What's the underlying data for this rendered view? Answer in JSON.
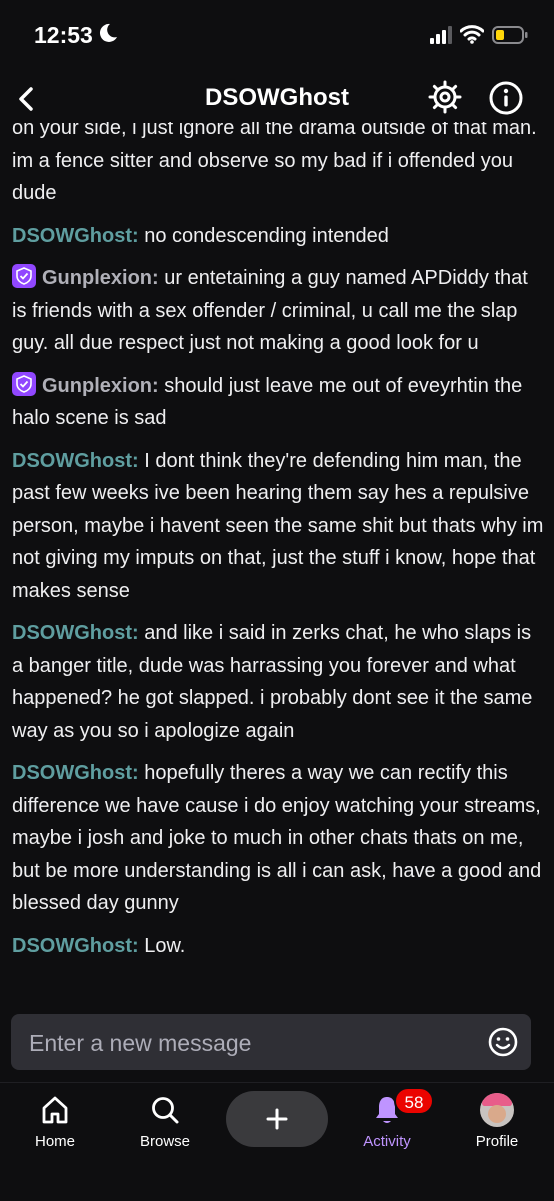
{
  "status_bar": {
    "time": "12:53"
  },
  "header": {
    "title": "DSOWGhost"
  },
  "colors": {
    "badge": "#9147ff",
    "ghost_name": "#5f9ea0",
    "gun_name": "#b0b0b8",
    "activity": "#bf94ff"
  },
  "messages": [
    {
      "user": "",
      "text": "on your side, i just ignore all the drama outside of that man. im a fence sitter and observe so my bad if i offended you dude",
      "badge": false,
      "name_color": ""
    },
    {
      "user": "DSOWGhost:",
      "text": " no condescending intended",
      "badge": false,
      "name_color": "#5f9ea0"
    },
    {
      "user": "Gunplexion:",
      "text": " ur entetaining a guy named APDiddy that is friends with a sex offender / criminal, u call me the slap guy. all due respect just not making a good look for u",
      "badge": true,
      "name_color": "#b0b0b8"
    },
    {
      "user": "Gunplexion:",
      "text": " should just leave me out of eveyrhtin the halo scene is sad",
      "badge": true,
      "name_color": "#b0b0b8"
    },
    {
      "user": "DSOWGhost:",
      "text": " I dont think they're defending him man, the past few weeks ive been hearing them say hes a repulsive person, maybe i havent seen the same shit but thats why im not giving my imputs on that, just the stuff i know, hope that makes sense",
      "badge": false,
      "name_color": "#5f9ea0"
    },
    {
      "user": "DSOWGhost:",
      "text": " and like i said in zerks chat, he who slaps is a banger title, dude was harrassing you forever and what happened? he got slapped. i probably dont see it the same way as you so i apologize again",
      "badge": false,
      "name_color": "#5f9ea0"
    },
    {
      "user": "DSOWGhost:",
      "text": " hopefully theres a way we can rectify this difference we have cause i do enjoy watching your streams, maybe i josh and joke to much in other chats thats on me, but be more understanding is all i can ask, have a good and blessed day gunny",
      "badge": false,
      "name_color": "#5f9ea0"
    },
    {
      "user": "DSOWGhost:",
      "text": " Low.",
      "badge": false,
      "name_color": "#5f9ea0"
    }
  ],
  "input": {
    "placeholder": "Enter a new message"
  },
  "nav": {
    "home": "Home",
    "browse": "Browse",
    "activity": "Activity",
    "activity_count": "58",
    "profile": "Profile"
  }
}
